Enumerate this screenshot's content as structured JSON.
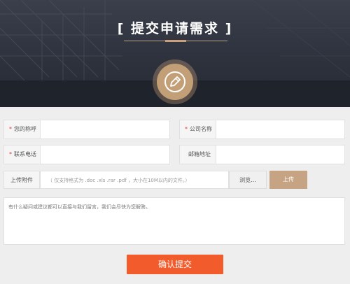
{
  "header": {
    "title": "[ 提交申请需求 ]",
    "icon": "edit-pencil-icon"
  },
  "form": {
    "name_label": "您的称呼",
    "company_label": "公司名称",
    "phone_label": "联系电话",
    "email_label": "邮箱地址",
    "required_mark": "*",
    "upload": {
      "label": "上传附件",
      "hint": "（ 仅支持格式为 .doc .xls .rar .pdf ，大小在10M以内的文件。）",
      "browse_label": "浏览...",
      "upload_label": "上传"
    },
    "message_placeholder": "有什么疑问或建议都可以直接与我们留言，我们会尽快为您解答。",
    "submit_label": "确认提交"
  },
  "colors": {
    "accent": "#c5a383",
    "submit": "#f25c2d",
    "required": "#e03a2d"
  }
}
